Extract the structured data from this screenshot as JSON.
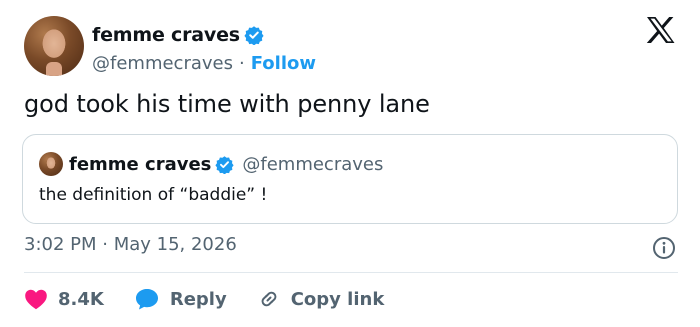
{
  "author": {
    "display_name": "femme craves",
    "handle": "@femmecraves",
    "separator": "·",
    "follow_label": "Follow"
  },
  "tweet": {
    "text": "god took his time with penny lane",
    "time": "3:02 PM · May 15, 2026"
  },
  "quoted": {
    "display_name": "femme craves",
    "handle": "@femmecraves",
    "text": "the definition of “baddie” !"
  },
  "actions": {
    "likes": "8.4K",
    "reply_label": "Reply",
    "copy_label": "Copy link"
  },
  "colors": {
    "accent": "#1d9bf0",
    "like": "#f91880",
    "text": "#0f1419",
    "muted": "#536471"
  },
  "icons": [
    "verified-badge-icon",
    "x-logo-icon",
    "info-icon",
    "heart-icon",
    "reply-bubble-icon",
    "link-icon"
  ]
}
